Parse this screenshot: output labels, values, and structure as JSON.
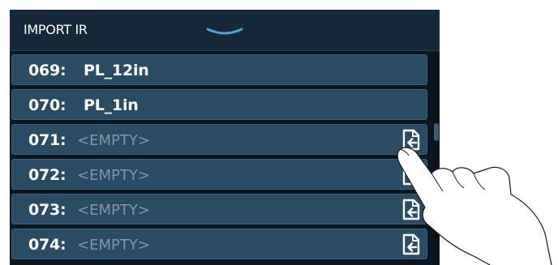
{
  "header": {
    "title": "IMPORT IR",
    "collapse_icon": "chevron-down-icon"
  },
  "rows": [
    {
      "number": "069:",
      "name": "PL_12in",
      "empty": false
    },
    {
      "number": "070:",
      "name": "PL_1in",
      "empty": false
    },
    {
      "number": "071:",
      "name": "<EMPTY>",
      "empty": true,
      "icon": "import-file-icon"
    },
    {
      "number": "072:",
      "name": "<EMPTY>",
      "empty": true,
      "icon": "import-file-icon"
    },
    {
      "number": "073:",
      "name": "<EMPTY>",
      "empty": true,
      "icon": "import-file-icon"
    },
    {
      "number": "074:",
      "name": "<EMPTY>",
      "empty": true,
      "icon": "import-file-icon"
    }
  ],
  "colors": {
    "background": "#0c1620",
    "header": "#15283a",
    "row": "#2a4b64",
    "row_border": "#3d6280",
    "text": "#ffffff",
    "empty_text": "#7f98ad"
  }
}
